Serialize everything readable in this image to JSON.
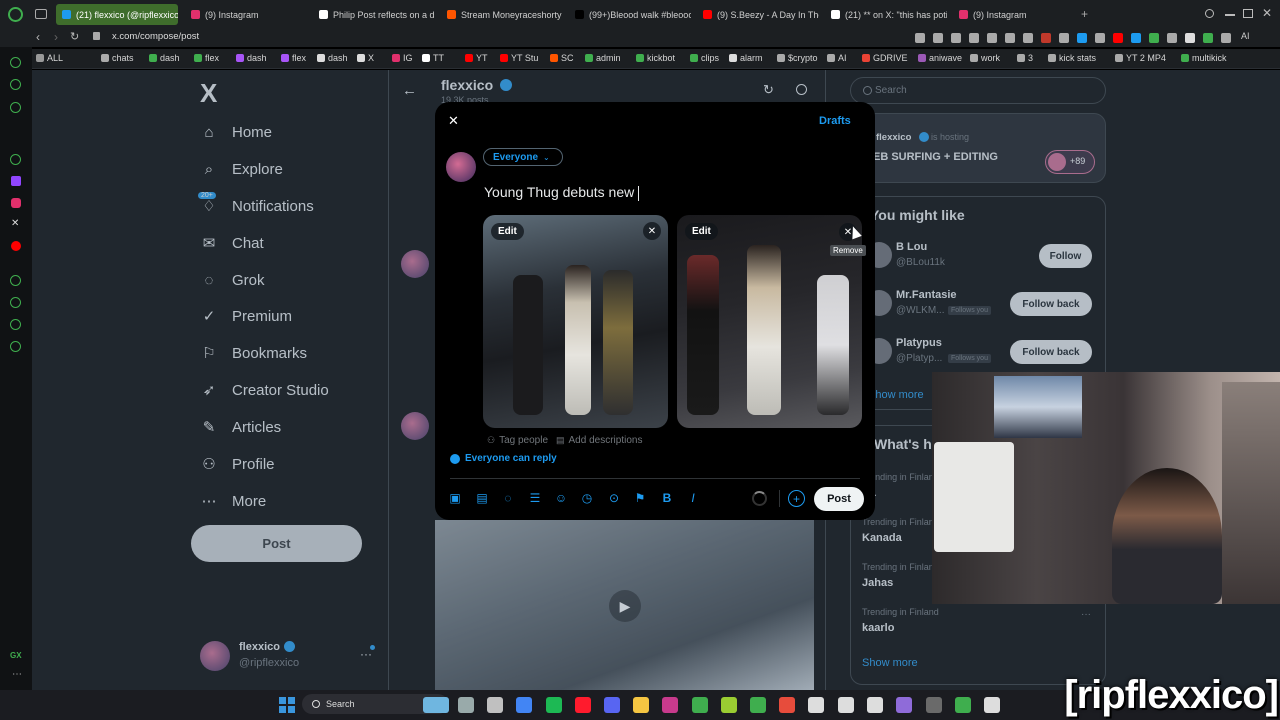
{
  "browser": {
    "tabs": [
      {
        "label": "(21) flexxico (@ripflexxico",
        "active": true,
        "color": "#1d9bf0"
      },
      {
        "label": "(9) Instagram",
        "color": "#e1306c"
      },
      {
        "label": "Philip Post reflects on a d",
        "color": "#ffffff"
      },
      {
        "label": "Stream Moneyraceshorty",
        "color": "#ff5500"
      },
      {
        "label": "(99+)Bleood walk #bleooo",
        "color": "#000000"
      },
      {
        "label": "(9) S.Beezy - A Day In The",
        "color": "#ff0000"
      },
      {
        "label": "(21) ** on X: \"this has poti",
        "color": "#ffffff"
      },
      {
        "label": "(9) Instagram",
        "color": "#e1306c"
      }
    ],
    "new_tab": "+",
    "url": "x.com/compose/post",
    "bookmarks": [
      "ALL",
      "chats",
      "dash",
      "flex",
      "dash",
      "flex",
      "dash",
      "X",
      "IG",
      "TT",
      "YT",
      "YT Stu",
      "SC",
      "admin",
      "kickbot",
      "clips",
      "alarm",
      "$crypto",
      "AI",
      "GDRIVE",
      "aniwave",
      "work",
      "3",
      "kick stats",
      "YT 2 MP4",
      "multikick"
    ],
    "ai_label": "AI"
  },
  "x": {
    "logo": "X",
    "nav": [
      {
        "label": "Home",
        "icon": "home-icon",
        "glyph": "⌂"
      },
      {
        "label": "Explore",
        "icon": "search-icon",
        "glyph": "⌕"
      },
      {
        "label": "Notifications",
        "icon": "bell-icon",
        "glyph": "♢",
        "badge": "20+"
      },
      {
        "label": "Chat",
        "icon": "mail-icon",
        "glyph": "✉"
      },
      {
        "label": "Grok",
        "icon": "grok-icon",
        "glyph": "◌"
      },
      {
        "label": "Premium",
        "icon": "verified-icon",
        "glyph": "✓"
      },
      {
        "label": "Bookmarks",
        "icon": "bookmark-icon",
        "glyph": "⚐"
      },
      {
        "label": "Creator Studio",
        "icon": "rocket-icon",
        "glyph": "➶"
      },
      {
        "label": "Articles",
        "icon": "article-icon",
        "glyph": "✎"
      },
      {
        "label": "Profile",
        "icon": "person-icon",
        "glyph": "⚇"
      },
      {
        "label": "More",
        "icon": "more-icon",
        "glyph": "⋯"
      }
    ],
    "post_button": "Post",
    "account": {
      "name": "flexxico",
      "handle": "@ripflexxico",
      "more": "···"
    },
    "profile_header": {
      "name": "flexxico",
      "sub": "19.3K posts"
    },
    "search_placeholder": "Search",
    "space": {
      "host": "flexxico",
      "hosting": "is hosting",
      "title": "EB SURFING + EDITING",
      "count": "+89"
    },
    "who_to_follow": {
      "title": "You might like",
      "users": [
        {
          "name": "B Lou",
          "handle": "@BLou11k",
          "button": "Follow",
          "follows_you": ""
        },
        {
          "name": "Mr.Fantasie",
          "handle": "@WLKM...",
          "button": "Follow back",
          "follows_you": "Follows you"
        },
        {
          "name": "Platypus",
          "handle": "@Platyp...",
          "button": "Follow back",
          "follows_you": "Follows you"
        }
      ],
      "show_more": "Show more"
    },
    "trends": {
      "title": "What's ha",
      "items": [
        {
          "context": "Trending in Finland",
          "name": "EL"
        },
        {
          "context": "Trending in Finland",
          "name": "Kanada"
        },
        {
          "context": "Trending in Finland",
          "name": "Jahas"
        },
        {
          "context": "Trending in Finland",
          "name": "kaarlo"
        }
      ],
      "show_more": "Show more"
    }
  },
  "composer": {
    "close": "✕",
    "drafts": "Drafts",
    "audience": "Everyone",
    "text": "Young Thug debuts new ",
    "images": [
      {
        "edit": "Edit",
        "remove": "✕"
      },
      {
        "edit": "Edit",
        "remove": "✕",
        "tooltip": "Remove"
      }
    ],
    "tag_people": "Tag people",
    "add_descriptions": "Add descriptions",
    "reply_setting": "Everyone can reply",
    "tools": [
      {
        "name": "media-icon",
        "glyph": "▣"
      },
      {
        "name": "gif-icon",
        "glyph": "▤"
      },
      {
        "name": "grok-icon",
        "glyph": "◌"
      },
      {
        "name": "poll-icon",
        "glyph": "☰"
      },
      {
        "name": "emoji-icon",
        "glyph": "☺"
      },
      {
        "name": "schedule-icon",
        "glyph": "◷"
      },
      {
        "name": "location-icon",
        "glyph": "⊙"
      },
      {
        "name": "flag-icon",
        "glyph": "⚑"
      },
      {
        "name": "bold-icon",
        "glyph": "B"
      },
      {
        "name": "italic-icon",
        "glyph": "I"
      }
    ],
    "add": "+",
    "post": "Post"
  },
  "stream": {
    "watermark": "[ripflexxico]"
  },
  "taskbar": {
    "search": "Search"
  }
}
